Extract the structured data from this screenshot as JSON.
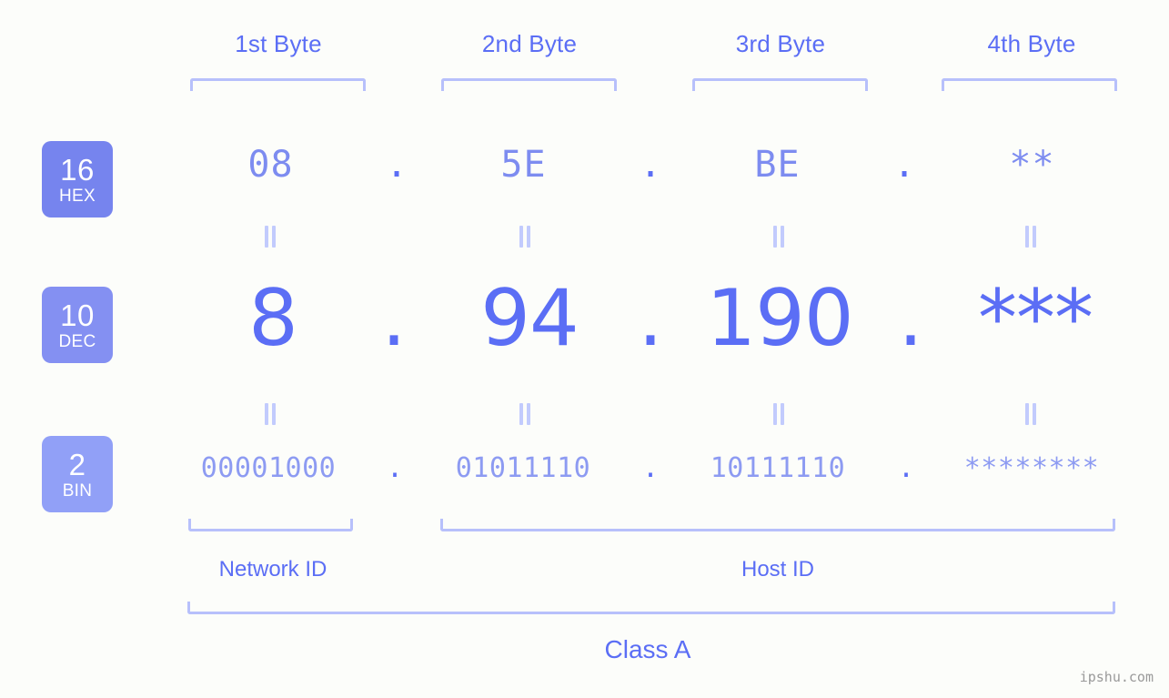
{
  "meta": {
    "background_color": "#fcfdfa",
    "accent_color": "#5b6ef5",
    "accent_light_color": "#b7c0fb",
    "value_color": "#7d8cf0"
  },
  "byte_headers": [
    {
      "label": "1st Byte"
    },
    {
      "label": "2nd Byte"
    },
    {
      "label": "3rd Byte"
    },
    {
      "label": "4th Byte"
    }
  ],
  "rows": [
    {
      "badge": {
        "radix": "16",
        "name": "HEX",
        "color": "#7684ee"
      },
      "values": [
        "08",
        "5E",
        "BE",
        "**"
      ],
      "separator": "."
    },
    {
      "badge": {
        "radix": "10",
        "name": "DEC",
        "color": "#8490f2"
      },
      "values": [
        "8",
        "94",
        "190",
        "***"
      ],
      "separator": "."
    },
    {
      "badge": {
        "radix": "2",
        "name": "BIN",
        "color": "#91a0f7"
      },
      "values": [
        "00001000",
        "01011110",
        "10111110",
        "********"
      ],
      "separator": "."
    }
  ],
  "equals_separator": "=",
  "id_sections": [
    {
      "label": "Network ID"
    },
    {
      "label": "Host ID"
    }
  ],
  "class_label": "Class A",
  "watermark": "ipshu.com"
}
